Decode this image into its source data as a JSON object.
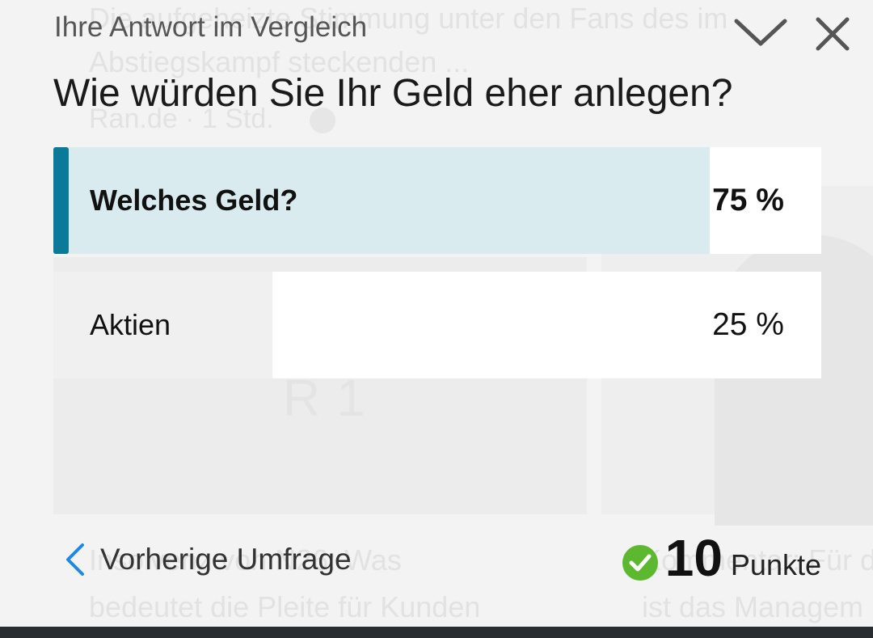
{
  "background_feed": {
    "article_1_title_line1": "Die aufgeheizte Stimmung unter den Fans des im",
    "article_1_title_line2": "Abstiegskampf steckenden ...",
    "article_1_source": "Ran.de · 1 Std.",
    "image_logo_text": "R1",
    "article_2_title_line1": "Insolvenz von N26: Was",
    "article_2_title_line2": "bedeutet die Pleite für Kunden",
    "article_3_title_line1": "Kommentar: Für d",
    "article_3_title_line2": "ist das Managem"
  },
  "poll": {
    "header_label": "Ihre Antwort im Vergleich",
    "question": "Wie würden Sie Ihr Geld eher anlegen?",
    "collapse_icon": "chevron-down-icon",
    "close_icon": "close-icon",
    "options": [
      {
        "label": "Welches Geld?",
        "percent_text": "75 %",
        "percent": 75,
        "selected": true
      },
      {
        "label": "Aktien",
        "percent_text": "25 %",
        "percent": 25,
        "selected": false
      }
    ],
    "accent_color": "#0b7a99",
    "selected_fill_color": "#d9ebef"
  },
  "footer": {
    "prev_label": "Vorherige Umfrage",
    "prev_icon": "chevron-left-icon",
    "points_value": "10",
    "points_unit": "Punkte",
    "check_icon": "check-circle-icon",
    "check_color": "#5cb82e"
  }
}
